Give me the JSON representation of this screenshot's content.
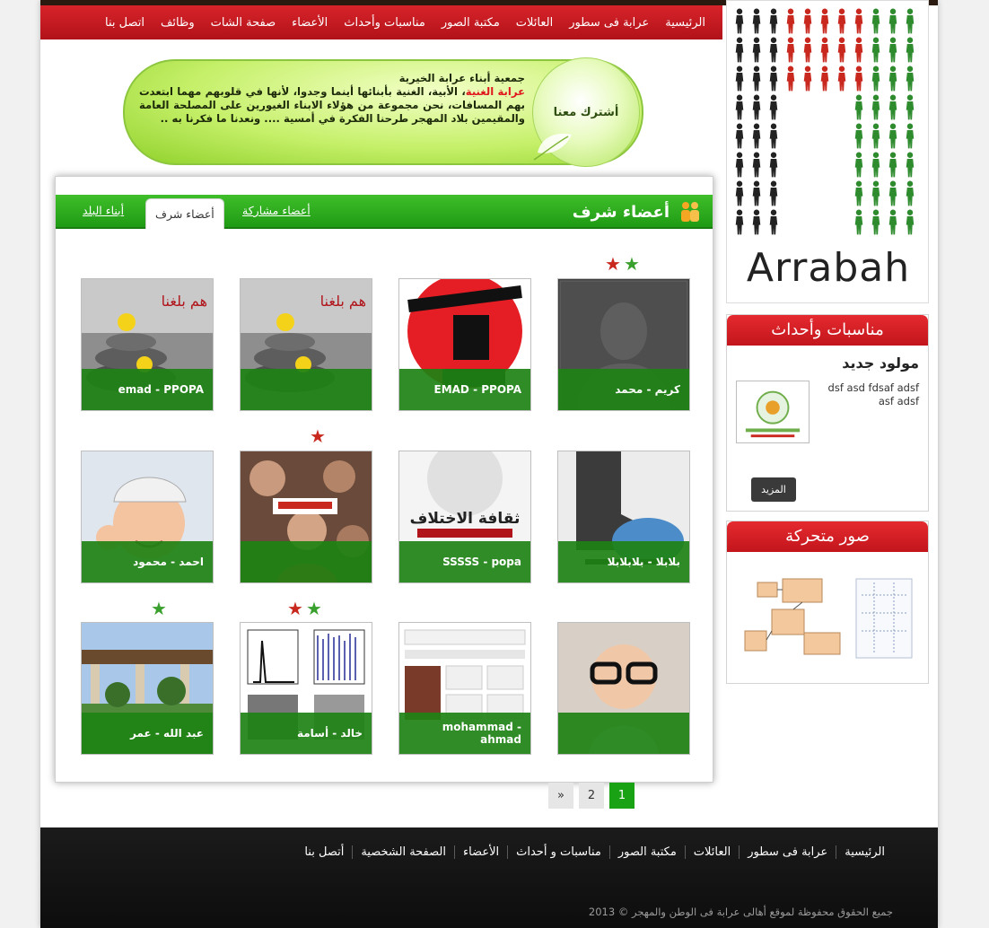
{
  "nav": {
    "items": [
      "الرئيسية",
      "عرابة فى سطور",
      "العائلات",
      "مكتبة الصور",
      "مناسبات وأحداث",
      "الأعضاء",
      "صفحة الشات",
      "وظائف",
      "اتصل بنا"
    ]
  },
  "logo": {
    "text": "Arrabah"
  },
  "banner": {
    "join_label": "أشترك معنا",
    "line1": "جمعية أبناء عرابة الخيرية",
    "highlight": "عرابة الغنية",
    "text": "، الأبية، الغنية بأبنائها أينما وجدوا، لأنها في قلوبهم مهما ابتعدت بهم المسافات، نحن مجموعة من هؤلاء الابناء الغيورين على المصلحة العامة والمقيمين بلاد المهجر طرحنا الفكرة في أمسية .... ونعدنا ما فكرنا به .."
  },
  "members_panel": {
    "title": "أعضاء شرف",
    "tabs": [
      "أعضاء مشاركة",
      "أعضاء شرف",
      "أبناء البلد"
    ],
    "active_tab": "أعضاء شرف"
  },
  "members": [
    {
      "name": "كريم - محمد",
      "stars": [
        "green",
        "red"
      ]
    },
    {
      "name": "EMAD - PPOPA",
      "stars": []
    },
    {
      "name": "",
      "stars": []
    },
    {
      "name": "emad - PPOPA",
      "stars": []
    },
    {
      "name": "بلابلا - بلابلابلا",
      "stars": []
    },
    {
      "name": "SSSSS - popa",
      "stars": []
    },
    {
      "name": "",
      "stars": [
        "red"
      ]
    },
    {
      "name": "احمد - محمود",
      "stars": []
    },
    {
      "name": "",
      "stars": []
    },
    {
      "name": "mohammad - ahmad",
      "stars": []
    },
    {
      "name": "خالد - أسامة",
      "stars": [
        "green",
        "red"
      ]
    },
    {
      "name": "عبد الله - عمر",
      "stars": [
        "green"
      ]
    }
  ],
  "pagination": {
    "pages": [
      "1",
      "2"
    ],
    "next": "»",
    "current": "1"
  },
  "events": {
    "title": "مناسبات وأحداث",
    "event_title": "مولود جديد",
    "event_desc": "dsf asd fdsaf adsf asf adsf",
    "more": "المزيد"
  },
  "gallery": {
    "title": "صور متحركة"
  },
  "footer": {
    "items": [
      "الرئيسية",
      "عرابة فى سطور",
      "العائلات",
      "مكتبة الصور",
      "مناسبات و أحداث",
      "الأعضاء",
      "الصفحة الشخصية",
      "أتصل بنا"
    ],
    "copyright": "جميع الحقوق محفوظة لموقع أهالى عرابة فى الوطن والمهجر © 2013"
  },
  "colors": {
    "brand_red": "#c3151c",
    "brand_green": "#1f9a14",
    "footer_bg": "#121212"
  }
}
